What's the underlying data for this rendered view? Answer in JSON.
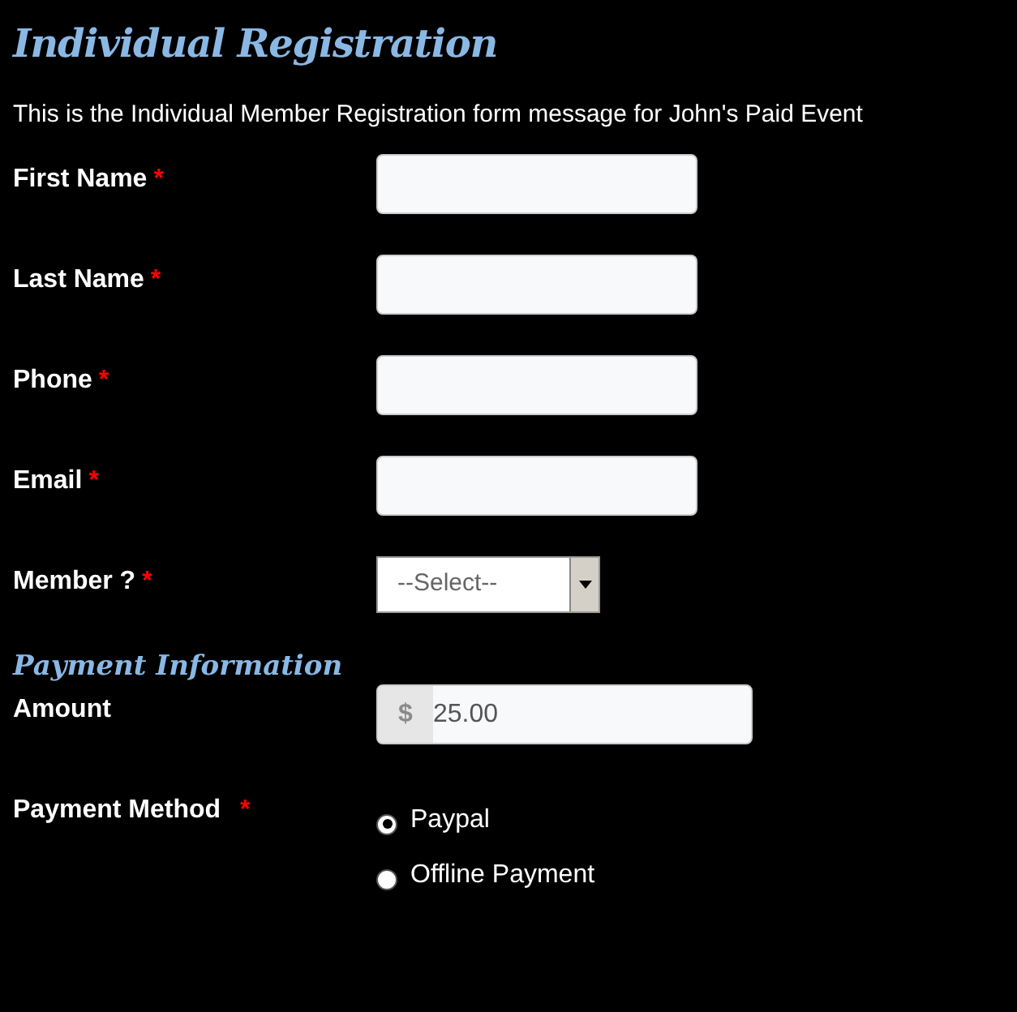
{
  "title": "Individual Registration",
  "message": "This is the Individual Member Registration form message for John's Paid Event",
  "fields": [
    {
      "label": "First Name",
      "required_mark": "*",
      "kind": "text"
    },
    {
      "label": "Last Name",
      "required_mark": "*",
      "kind": "text"
    },
    {
      "label": "Phone",
      "required_mark": "*",
      "kind": "text"
    },
    {
      "label": "Email",
      "required_mark": "*",
      "kind": "text"
    },
    {
      "label": "Member ?",
      "required_mark": "*",
      "kind": "select",
      "value": "--Select--"
    }
  ],
  "payment": {
    "heading": "Payment Information",
    "amount": {
      "label": "Amount",
      "currency": "$",
      "value": "25.00"
    },
    "method": {
      "label": "Payment Method",
      "required_mark": "*",
      "options": [
        {
          "label": "Paypal",
          "selected": true
        },
        {
          "label": "Offline Payment",
          "selected": false
        }
      ]
    }
  }
}
